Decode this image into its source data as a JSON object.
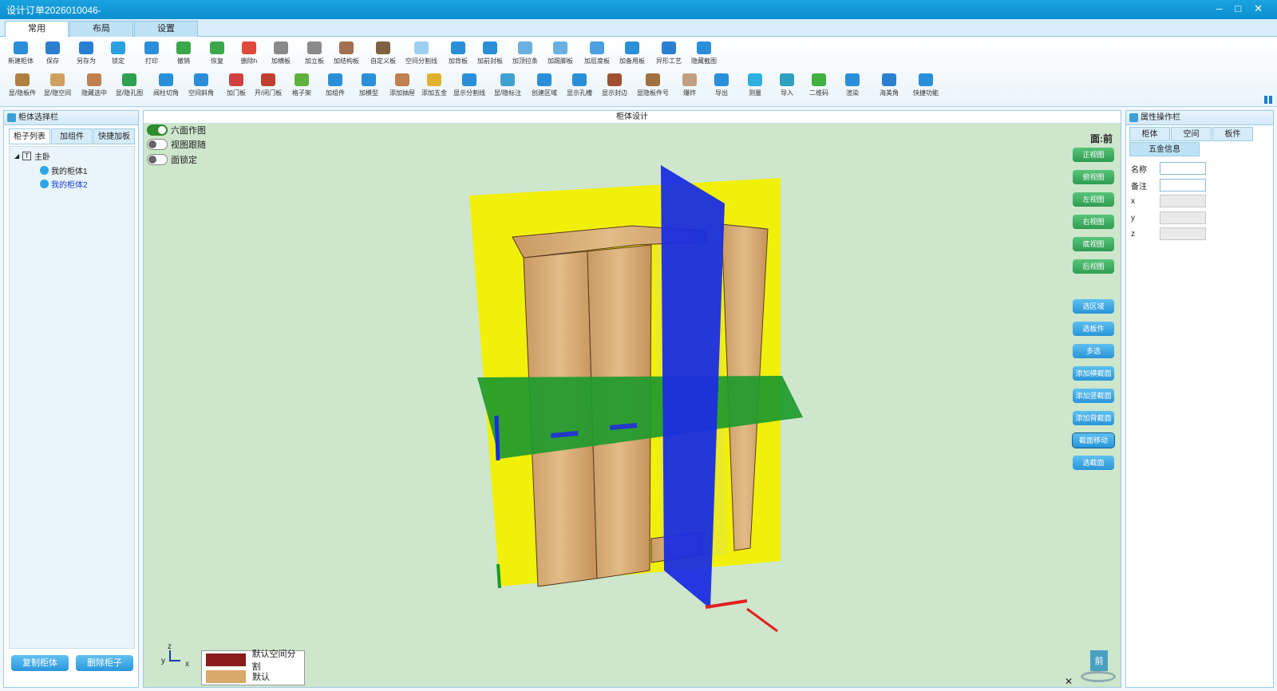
{
  "window": {
    "title": "设计订单2026010046-",
    "controls": [
      "–",
      "□",
      "✕"
    ]
  },
  "main_tabs": [
    {
      "label": "常用",
      "active": true
    },
    {
      "label": "布局",
      "active": false
    },
    {
      "label": "设置",
      "active": false
    }
  ],
  "toolbar_row1": [
    {
      "label": "新建柜体",
      "icon": "new-cabinet-icon",
      "color": "#2a8fd8"
    },
    {
      "label": "保存",
      "icon": "save-icon",
      "color": "#2a7fd0"
    },
    {
      "label": "另存为",
      "icon": "save-as-icon",
      "color": "#2a7fd0"
    },
    {
      "label": "锁定",
      "icon": "lock-icon",
      "color": "#2aa0e0"
    },
    {
      "label": "打印",
      "icon": "print-icon",
      "color": "#2a8fd8"
    },
    {
      "label": "撤销",
      "icon": "undo-icon",
      "color": "#3aa84a"
    },
    {
      "label": "恢复",
      "icon": "redo-icon",
      "color": "#3aa84a"
    },
    {
      "label": "删除h",
      "icon": "delete-icon",
      "color": "#e04a3a"
    },
    {
      "label": "加横板",
      "icon": "horizontal-board-icon",
      "color": "#8a8a8a"
    },
    {
      "label": "加立板",
      "icon": "vertical-board-icon",
      "color": "#8a8a8a"
    },
    {
      "label": "加结构板",
      "icon": "structure-board-icon",
      "color": "#a07050"
    },
    {
      "label": "自定义板",
      "icon": "custom-board-icon",
      "color": "#806040"
    },
    {
      "label": "空间分割线",
      "icon": "space-split-icon",
      "color": "#9cd0f0"
    },
    {
      "label": "加背板",
      "icon": "back-board-icon",
      "color": "#2a8fd8"
    },
    {
      "label": "加前封板",
      "icon": "front-seal-icon",
      "color": "#2a8fd8"
    },
    {
      "label": "加顶拉条",
      "icon": "top-strip-icon",
      "color": "#6ab0e0"
    },
    {
      "label": "加踢脚板",
      "icon": "kickboard-icon",
      "color": "#6ab0e0"
    },
    {
      "label": "加层度板",
      "icon": "layer-board-icon",
      "color": "#4aa0e0"
    },
    {
      "label": "加备用板",
      "icon": "spare-board-icon",
      "color": "#2a8fd8"
    },
    {
      "label": "异形工艺",
      "icon": "special-craft-icon",
      "color": "#2a7fd0"
    },
    {
      "label": "隐藏截图",
      "icon": "hide-screenshot-icon",
      "color": "#2a8fd8"
    }
  ],
  "toolbar_row2": [
    {
      "label": "显/隐板件",
      "icon": "show-boards-icon",
      "color": "#b08040"
    },
    {
      "label": "显/隐空间",
      "icon": "show-space-icon",
      "color": "#d0a060"
    },
    {
      "label": "隐藏选中",
      "icon": "hide-selected-icon",
      "color": "#c08050"
    },
    {
      "label": "显/隐孔图",
      "icon": "show-holes-icon",
      "color": "#30a050"
    },
    {
      "label": "阀柱切角",
      "icon": "pillar-cut-icon",
      "color": "#2a8fd8"
    },
    {
      "label": "空间斜角",
      "icon": "space-bevel-icon",
      "color": "#2a8fd8"
    },
    {
      "label": "加门板",
      "icon": "door-board-icon",
      "color": "#d04040"
    },
    {
      "label": "开/闭门板",
      "icon": "open-door-icon",
      "color": "#c04030"
    },
    {
      "label": "格子架",
      "icon": "grid-rack-icon",
      "color": "#60b040"
    },
    {
      "label": "加组件",
      "icon": "add-component-icon",
      "color": "#2a8fd8"
    },
    {
      "label": "加模型",
      "icon": "add-model-icon",
      "color": "#2a8fd8"
    },
    {
      "label": "添加抽屉",
      "icon": "add-drawer-icon",
      "color": "#c08050"
    },
    {
      "label": "添加五金",
      "icon": "add-hardware-icon",
      "color": "#e0b030"
    },
    {
      "label": "显示分割线",
      "icon": "show-split-icon",
      "color": "#2a8fd8"
    },
    {
      "label": "显/隐标注",
      "icon": "show-annotation-icon",
      "color": "#40a0d0"
    },
    {
      "label": "创建区域",
      "icon": "create-area-icon",
      "color": "#2a8fd8"
    },
    {
      "label": "显示孔槽",
      "icon": "show-slot-icon",
      "color": "#2a8fd8"
    },
    {
      "label": "显示封边",
      "icon": "show-edge-icon",
      "color": "#a05030"
    },
    {
      "label": "显隐板件号",
      "icon": "board-number-icon",
      "color": "#a07040"
    },
    {
      "label": "爆炸",
      "icon": "explode-icon",
      "color": "#c0a080"
    },
    {
      "label": "导出",
      "icon": "export-icon",
      "color": "#2a8fd8"
    },
    {
      "label": "测量",
      "icon": "measure-icon",
      "color": "#30b0e0"
    },
    {
      "label": "导入",
      "icon": "import-icon",
      "color": "#30a0c0"
    },
    {
      "label": "二维码",
      "icon": "qrcode-icon",
      "color": "#40b040"
    },
    {
      "label": "渲染",
      "icon": "render-icon",
      "color": "#2a8fd8"
    },
    {
      "label": "海美角",
      "icon": "corner-icon",
      "color": "#2a7fd0"
    },
    {
      "label": "快捷功能",
      "icon": "quick-function-icon",
      "color": "#2a8fd8"
    }
  ],
  "left_panel": {
    "title": "柜体选择栏",
    "tabs": [
      "柜子列表",
      "加组件",
      "快捷加板"
    ],
    "tree_root": "主卧",
    "tree_items": [
      "我的柜体1",
      "我的柜体2"
    ],
    "copy_button": "复制柜体",
    "delete_button": "删除柜子"
  },
  "center": {
    "title": "柜体设计",
    "toggles": [
      {
        "label": "六面作图",
        "on": true
      },
      {
        "label": "视图跟随",
        "on": false
      },
      {
        "label": "面锁定",
        "on": false
      }
    ],
    "face_label": "面:前",
    "view_buttons": [
      "正视图",
      "俯视图",
      "左视图",
      "右视图",
      "底视图",
      "后视图"
    ],
    "action_buttons": [
      "选区域",
      "选板件",
      "多选",
      "添加横截面",
      "添加竖截面",
      "添加背截面",
      "截面移动",
      "选截面"
    ],
    "selected_action": "截面移动",
    "legend": [
      {
        "label": "默认空间分割",
        "color": "#8b1a1a"
      },
      {
        "label": "默认",
        "color": "#d9a86a"
      }
    ],
    "axes": {
      "x": "x",
      "y": "y",
      "z": "z"
    },
    "cube_label": "前",
    "close_symbol": "✕"
  },
  "right_panel": {
    "title": "属性操作栏",
    "tabs": [
      "柜体",
      "空间",
      "板件",
      "五金信息"
    ],
    "fields": [
      {
        "label": "名称",
        "value": ""
      },
      {
        "label": "备注",
        "value": ""
      },
      {
        "label": "x",
        "value": ""
      },
      {
        "label": "y",
        "value": ""
      },
      {
        "label": "z",
        "value": ""
      }
    ]
  }
}
